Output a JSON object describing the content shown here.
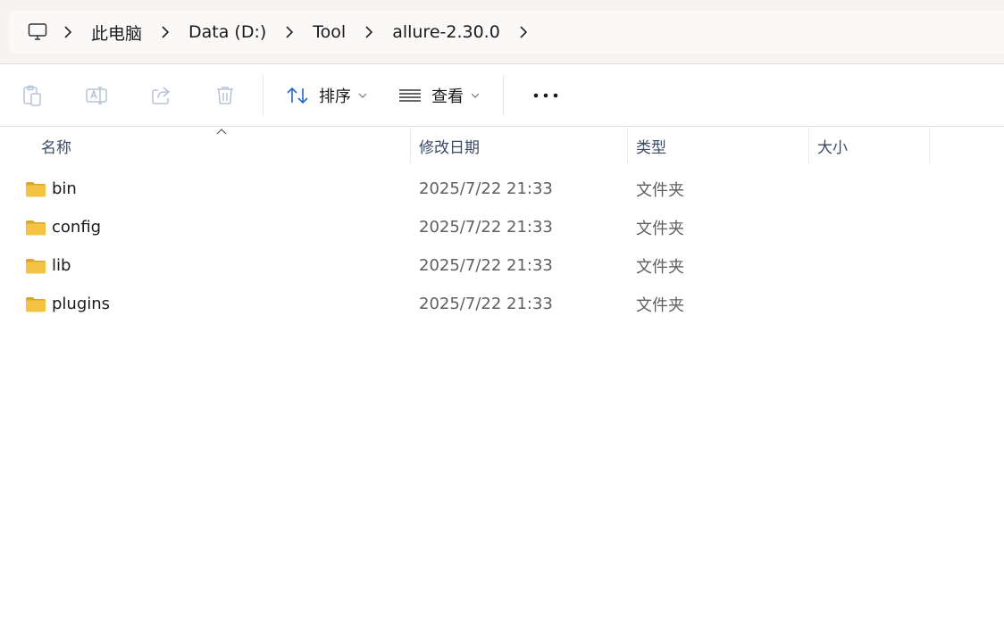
{
  "address_bar": {
    "pc_icon": "monitor-icon",
    "crumbs": [
      "此电脑",
      "Data (D:)",
      "Tool",
      "allure-2.30.0"
    ]
  },
  "toolbar": {
    "icons": [
      "paste-icon",
      "rename-icon",
      "share-icon",
      "delete-icon"
    ],
    "sort_label": "排序",
    "view_label": "查看",
    "more_icon": "more-icon"
  },
  "columns": {
    "name": "名称",
    "date_modified": "修改日期",
    "type": "类型",
    "size": "大小"
  },
  "files": [
    {
      "name": "bin",
      "date": "2025/7/22 21:33",
      "type": "文件夹",
      "size": ""
    },
    {
      "name": "config",
      "date": "2025/7/22 21:33",
      "type": "文件夹",
      "size": ""
    },
    {
      "name": "lib",
      "date": "2025/7/22 21:33",
      "type": "文件夹",
      "size": ""
    },
    {
      "name": "plugins",
      "date": "2025/7/22 21:33",
      "type": "文件夹",
      "size": ""
    }
  ],
  "colors": {
    "accent": "#2a66c4",
    "folder": "#f5c344",
    "header_text": "#3b4a63"
  }
}
